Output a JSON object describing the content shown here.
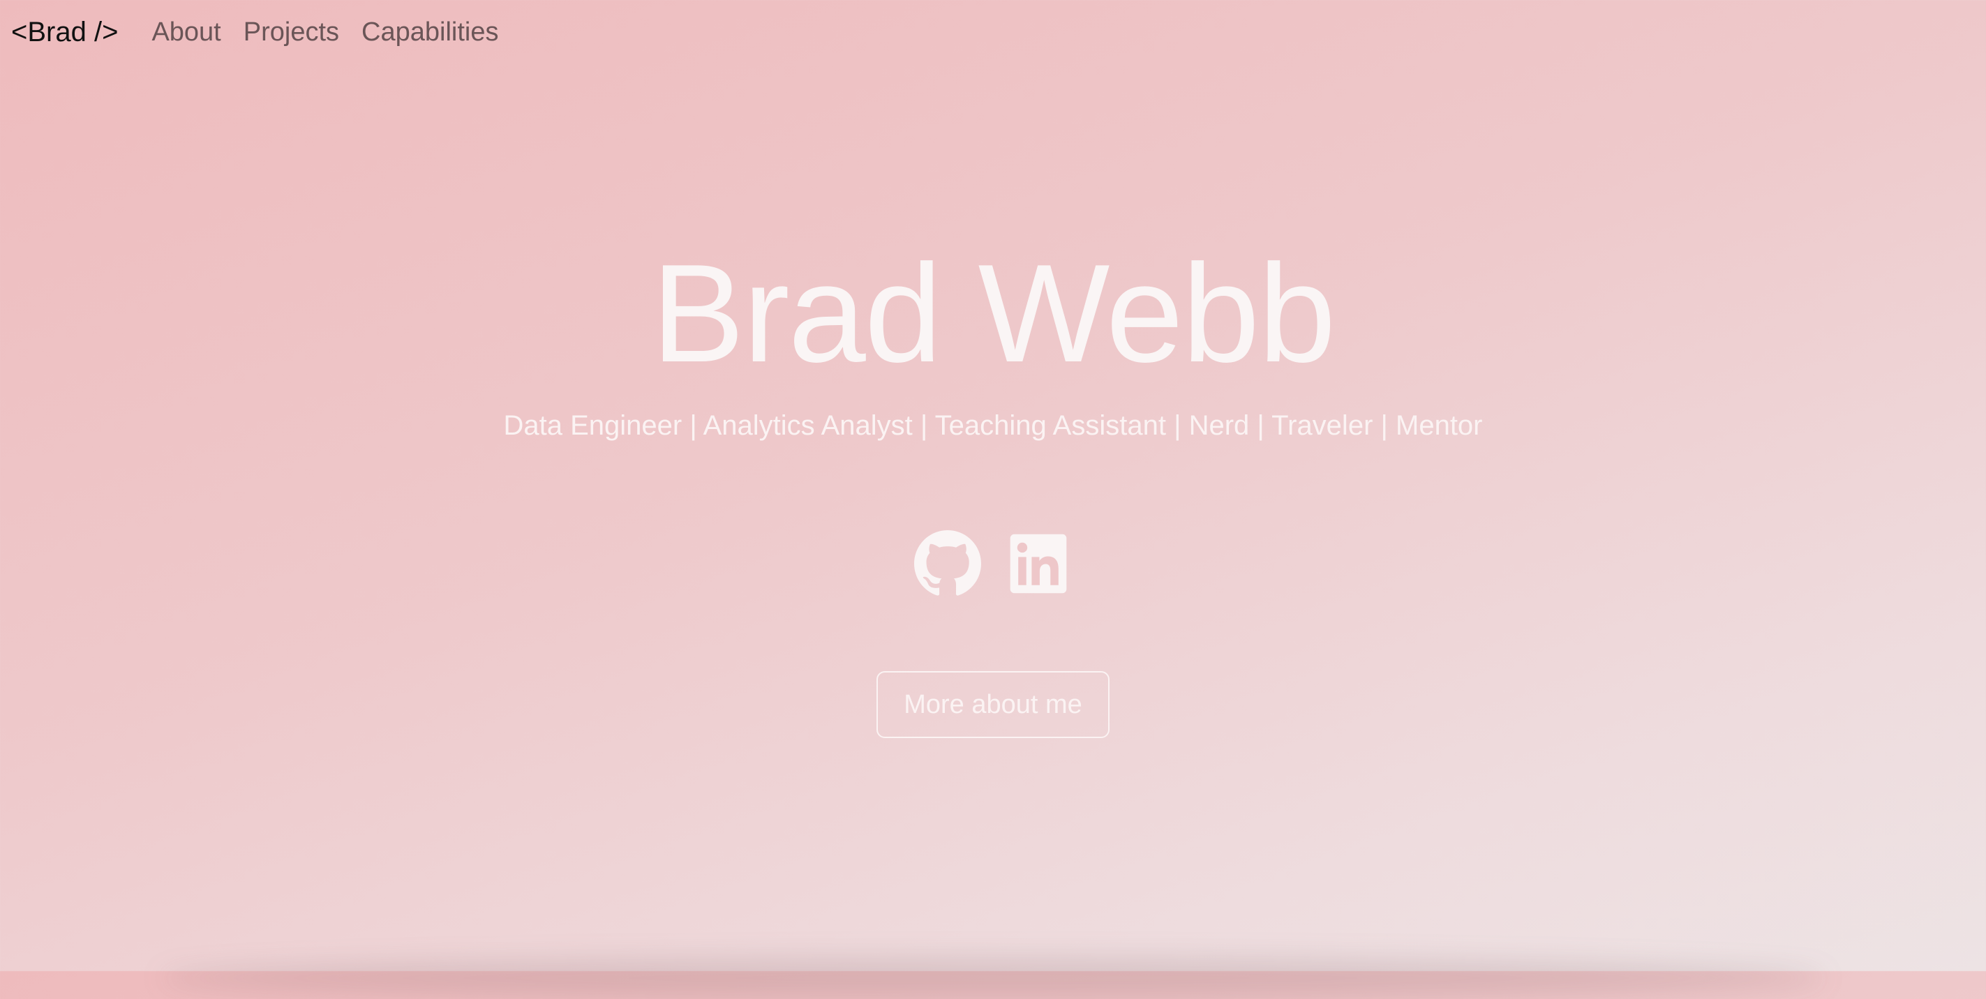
{
  "nav": {
    "brand": "<Brad />",
    "links": [
      "About",
      "Projects",
      "Capabilities"
    ]
  },
  "hero": {
    "title": "Brad Webb",
    "subtitle": "Data Engineer | Analytics Analyst | Teaching Assistant | Nerd | Traveler | Mentor",
    "cta_label": "More about me"
  },
  "socials": [
    {
      "icon": "github-icon"
    },
    {
      "icon": "linkedin-icon"
    }
  ],
  "colors": {
    "background_start": "#eebbbd",
    "background_end": "#ede3e4",
    "hero_text": "#faf5f5",
    "brand_text": "#111111",
    "nav_text": "#6a5557"
  }
}
